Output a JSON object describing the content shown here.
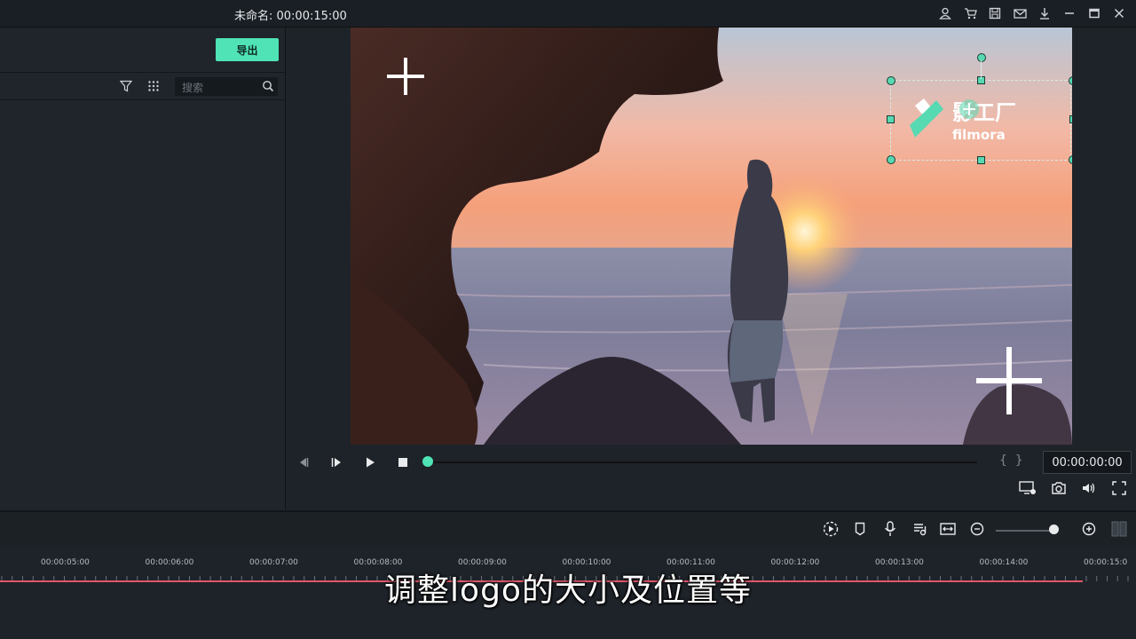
{
  "titlebar": {
    "title": "未命名: 00:00:15:00",
    "icons": [
      "user-icon",
      "cart-icon",
      "save-icon",
      "mail-icon",
      "download-icon",
      "minimize-icon",
      "maximize-icon",
      "close-icon"
    ]
  },
  "left_panel": {
    "export_label": "导出",
    "search_placeholder": "搜索"
  },
  "preview": {
    "logo_text": "影工厂",
    "logo_sub": "filmora",
    "timecode": "00:00:00:00",
    "progress": 0
  },
  "timeline": {
    "ticks": [
      "00:00:05:00",
      "00:00:06:00",
      "00:00:07:00",
      "00:00:08:00",
      "00:00:09:00",
      "00:00:10:00",
      "00:00:11:00",
      "00:00:12:00",
      "00:00:13:00",
      "00:00:14:00",
      "00:00:15:0"
    ]
  },
  "subtitle": "调整logo的大小及位置等",
  "colors": {
    "accent": "#4fe3b5",
    "playhead": "#e0566a",
    "background": "#1e2329"
  }
}
